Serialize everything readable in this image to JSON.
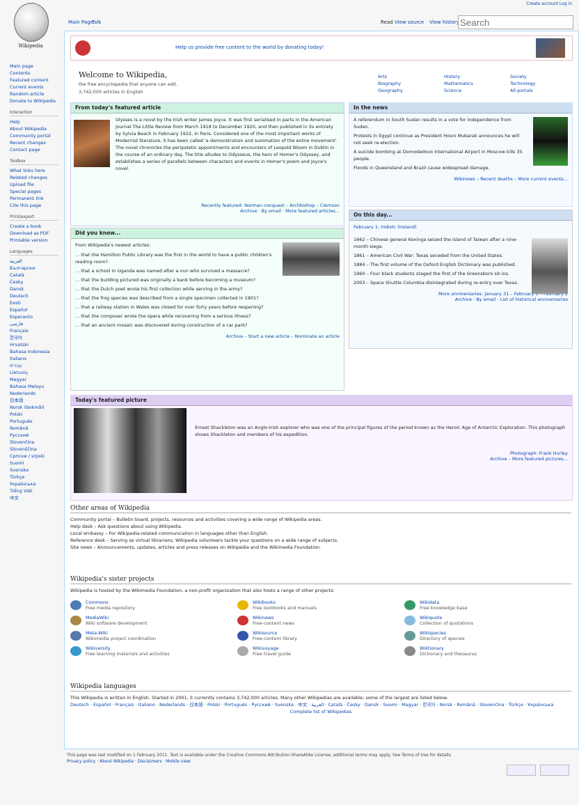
{
  "sidebar": {
    "logo_text": "Wikipedia",
    "sections": [
      {
        "heading": "",
        "items": [
          "Main page",
          "Contents",
          "Featured content",
          "Current events",
          "Random article",
          "Donate to Wikipedia"
        ]
      },
      {
        "heading": "Interaction",
        "items": [
          "Help",
          "About Wikipedia",
          "Community portal",
          "Recent changes",
          "Contact page"
        ]
      },
      {
        "heading": "Toolbox",
        "items": [
          "What links here",
          "Related changes",
          "Upload file",
          "Special pages",
          "Permanent link",
          "Cite this page"
        ]
      },
      {
        "heading": "Print/export",
        "items": [
          "Create a book",
          "Download as PDF",
          "Printable version"
        ]
      },
      {
        "heading": "Languages",
        "items": [
          "العربية",
          "Български",
          "Català",
          "Česky",
          "Dansk",
          "Deutsch",
          "Eesti",
          "Español",
          "Esperanto",
          "فارسی",
          "Français",
          "한국어",
          "Hrvatski",
          "Bahasa Indonesia",
          "Italiano",
          "עברית",
          "Lietuvių",
          "Magyar",
          "Bahasa Melayu",
          "Nederlands",
          "日本語",
          "Norsk (bokmål)",
          "Polski",
          "Português",
          "Română",
          "Русский",
          "Slovenčina",
          "Slovenščina",
          "Српски / srpski",
          "Suomi",
          "Svenska",
          "Türkçe",
          "Українська",
          "Tiếng Việt",
          "中文"
        ]
      }
    ]
  },
  "header": {
    "tabs": [
      "Main Page",
      "Talk"
    ],
    "right_tabs": [
      "Read",
      "View source",
      "View history"
    ],
    "personal": "Create account   Log in",
    "search_placeholder": "Search"
  },
  "banner": {
    "text": "Help us provide free content to the world by donating today!"
  },
  "welcome": {
    "title": "Welcome to Wikipedia,",
    "subtitle": "the free encyclopedia that anyone can edit.",
    "count": "3,742,000 articles in English"
  },
  "portals": [
    "Arts",
    "Biography",
    "Geography",
    "History",
    "Mathematics",
    "Science",
    "Society",
    "Technology",
    "All portals"
  ],
  "featured": {
    "heading": "From today's featured article",
    "text": "Ulysses is a novel by the Irish writer James Joyce. It was first serialised in parts in the American journal The Little Review from March 1918 to December 1920, and then published in its entirety by Sylvia Beach in February 1922, in Paris. Considered one of the most important works of Modernist literature, it has been called 'a demonstration and summation of the entire movement'. The novel chronicles the peripatetic appointments and encounters of Leopold Bloom in Dublin in the course of an ordinary day. The title alludes to Odysseus, the hero of Homer's Odyssey, and establishes a series of parallels between characters and events in Homer's poem and Joyce's novel.",
    "more": "Recently featured: Norman conquest – Archbishop – Clemson",
    "links": "Archive · By email · More featured articles..."
  },
  "itn": {
    "heading": "In the news",
    "items": [
      "A referendum in South Sudan results in a vote for independence from Sudan.",
      "Protests in Egypt continue as President Hosni Mubarak announces he will not seek re-election.",
      "A suicide bombing at Domodedovo International Airport in Moscow kills 35 people.",
      "Floods in Queensland and Brazil cause widespread damage."
    ],
    "more": "Wikinews – Recent deaths – More current events..."
  },
  "dyk": {
    "heading": "Did you know...",
    "intro": "From Wikipedia's newest articles:",
    "items": [
      "... that the Hamilton Public Library was the first in the world to have a public children's reading room?",
      "... that a school in Uganda was named after a nun who survived a massacre?",
      "... that the building pictured was originally a bank before becoming a museum?",
      "... that the Dutch poet wrote his first collection while serving in the army?",
      "... that the frog species was described from a single specimen collected in 1901?",
      "... that a railway station in Wales was closed for over forty years before reopening?",
      "... that the composer wrote the opera while recovering from a serious illness?",
      "... that an ancient mosaic was discovered during construction of a car park?"
    ],
    "more": "Archive – Start a new article – Nominate an article"
  },
  "otd": {
    "heading": "On this day...",
    "date": "February 1: Imbolc (Ireland)",
    "items": [
      "1662 – Chinese general Koxinga seized the island of Taiwan after a nine-month siege.",
      "1861 – American Civil War: Texas seceded from the United States.",
      "1884 – The first volume of the Oxford English Dictionary was published.",
      "1960 – Four black students staged the first of the Greensboro sit-ins.",
      "2003 – Space Shuttle Columbia disintegrated during re-entry over Texas."
    ],
    "more": "More anniversaries: January 31 – February 1 – February 2",
    "links": "Archive · By email · List of historical anniversaries"
  },
  "picture": {
    "heading": "Today's featured picture",
    "text": "Ernest Shackleton was an Anglo-Irish explorer who was one of the principal figures of the period known as the Heroic Age of Antarctic Exploration. This photograph shows Shackleton and members of his expedition.",
    "credit": "Photograph: Frank Hurley",
    "more": "Archive – More featured pictures..."
  },
  "other_areas": {
    "title": "Other areas of Wikipedia",
    "items": [
      "Community portal – Bulletin board, projects, resources and activities covering a wide range of Wikipedia areas.",
      "Help desk – Ask questions about using Wikipedia.",
      "Local embassy – For Wikipedia-related communication in languages other than English.",
      "Reference desk – Serving as virtual librarians, Wikipedia volunteers tackle your questions on a wide range of subjects.",
      "Site news – Announcements, updates, articles and press releases on Wikipedia and the Wikimedia Foundation."
    ]
  },
  "sister": {
    "title": "Wikipedia's sister projects",
    "intro": "Wikipedia is hosted by the Wikimedia Foundation, a non-profit organization that also hosts a range of other projects:",
    "projects": [
      {
        "name": "Commons",
        "desc": "Free media repository",
        "color": "#4a7bb7"
      },
      {
        "name": "Wikibooks",
        "desc": "Free textbooks and manuals",
        "color": "#e6b800"
      },
      {
        "name": "Wikidata",
        "desc": "Free knowledge base",
        "color": "#339966"
      },
      {
        "name": "MediaWiki",
        "desc": "Wiki software development",
        "color": "#aa8844"
      },
      {
        "name": "Wikinews",
        "desc": "Free-content news",
        "color": "#cc3333"
      },
      {
        "name": "Wikiquote",
        "desc": "Collection of quotations",
        "color": "#88bbdd"
      },
      {
        "name": "Meta-Wiki",
        "desc": "Wikimedia project coordination",
        "color": "#5577aa"
      },
      {
        "name": "Wikisource",
        "desc": "Free-content library",
        "color": "#3355aa"
      },
      {
        "name": "Wikispecies",
        "desc": "Directory of species",
        "color": "#669999"
      },
      {
        "name": "Wikiversity",
        "desc": "Free learning materials and activities",
        "color": "#3399cc"
      },
      {
        "name": "Wikivoyage",
        "desc": "Free travel guide",
        "color": "#aaaaaa"
      },
      {
        "name": "Wiktionary",
        "desc": "Dictionary and thesaurus",
        "color": "#888888"
      }
    ]
  },
  "languages": {
    "title": "Wikipedia languages",
    "text": "This Wikipedia is written in English. Started in 2001, it currently contains 3,742,000 articles. Many other Wikipedias are available; some of the largest are listed below.",
    "list": "Deutsch · Español · Français · Italiano · Nederlands · 日本語 · Polski · Português · Русский · Svenska · 中文 · العربية · Català · Česky · Dansk · Suomi · Magyar · 한국어 · Norsk · Română · Slovenčina · Türkçe · Українська",
    "more": "Complete list of Wikipedias"
  },
  "footer": {
    "text": "This page was last modified on 1 February 2011. Text is available under the Creative Commons Attribution-ShareAlike License; additional terms may apply. See Terms of Use for details.",
    "links": "Privacy policy · About Wikipedia · Disclaimers · Mobile view"
  }
}
